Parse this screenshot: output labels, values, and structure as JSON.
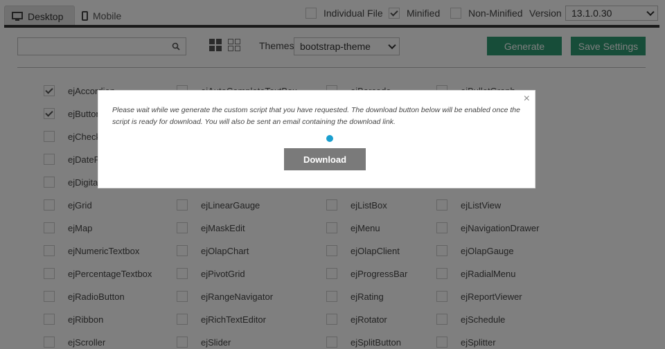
{
  "tabs": {
    "desktop": "Desktop",
    "mobile": "Mobile"
  },
  "options": {
    "individual_file": {
      "label": "Individual File",
      "checked": false
    },
    "minified": {
      "label": "Minified",
      "checked": true
    },
    "non_minified": {
      "label": "Non-Minified",
      "checked": false
    }
  },
  "version": {
    "label": "Version",
    "value": "13.1.0.30"
  },
  "search": {
    "placeholder": "",
    "value": ""
  },
  "themes": {
    "label": "Themes",
    "value": "bootstrap-theme"
  },
  "buttons": {
    "generate": "Generate",
    "save_settings": "Save Settings"
  },
  "controls": [
    [
      "ejAccordion",
      "ejAutoCompleteTextBox",
      "ejBarcode",
      "ejBulletGraph"
    ],
    [
      "ejButton",
      "",
      "",
      ""
    ],
    [
      "ejCheck",
      "",
      "",
      ""
    ],
    [
      "ejDateP",
      "",
      "",
      ""
    ],
    [
      "ejDigita",
      "",
      "",
      ""
    ],
    [
      "ejGrid",
      "ejLinearGauge",
      "ejListBox",
      "ejListView"
    ],
    [
      "ejMap",
      "ejMaskEdit",
      "ejMenu",
      "ejNavigationDrawer"
    ],
    [
      "ejNumericTextbox",
      "ejOlapChart",
      "ejOlapClient",
      "ejOlapGauge"
    ],
    [
      "ejPercentageTextbox",
      "ejPivotGrid",
      "ejProgressBar",
      "ejRadialMenu"
    ],
    [
      "ejRadioButton",
      "ejRangeNavigator",
      "ejRating",
      "ejReportViewer"
    ],
    [
      "ejRibbon",
      "ejRichTextEditor",
      "ejRotator",
      "ejSchedule"
    ],
    [
      "ejScroller",
      "ejSlider",
      "ejSplitButton",
      "ejSplitter"
    ]
  ],
  "checked": [
    [
      true,
      false,
      false,
      false
    ],
    [
      true,
      false,
      false,
      false
    ]
  ],
  "dialog": {
    "message": "Please wait while we generate the custom script that you have requested. The download button below will be enabled once the script is ready for download. You will also be sent an email containing the download link.",
    "download_label": "Download",
    "close_glyph": "×"
  },
  "colors": {
    "accent_green": "#2f9a73",
    "progress_dot": "#1a9fcf",
    "overlay": "rgba(0,0,0,0.5)"
  }
}
